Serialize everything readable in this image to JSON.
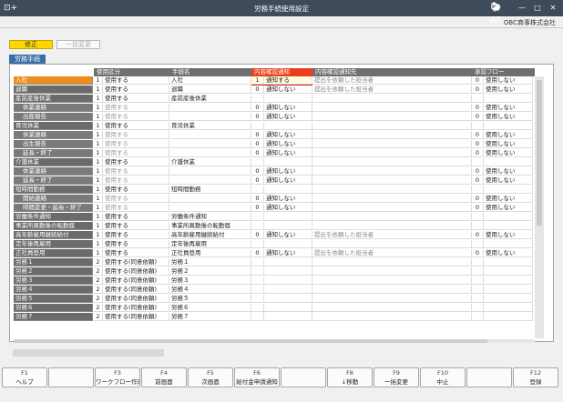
{
  "window": {
    "title": "労務手続使用設定",
    "app_icon": "⊡+",
    "logo": "🐑AT",
    "min": "—",
    "max": "□",
    "close": "✕"
  },
  "company": "OBC商事株式会社",
  "modes": {
    "edit": "修正",
    "bulk": "一括変更"
  },
  "tab": "労務手続",
  "headers": {
    "usage": "使用区分",
    "procedure": "手続名",
    "notify": "内容確認通知",
    "dest": "内容確認通知先",
    "flow": "承認フロー"
  },
  "rows": [
    {
      "name": "入社",
      "k1": "1",
      "v1": "使用する",
      "proc": "入社",
      "k2": "1",
      "v2": "通知する",
      "dest": "提出を依頼した担当者",
      "k3": "0",
      "v3": "使用しない",
      "sel": true,
      "sub": false
    },
    {
      "name": "退職",
      "k1": "1",
      "v1": "使用する",
      "proc": "退職",
      "k2": "0",
      "v2": "通知しない",
      "dest": "提出を依頼した担当者",
      "k3": "0",
      "v3": "使用しない",
      "sel": false,
      "sub": false
    },
    {
      "name": "産前産後休業",
      "k1": "1",
      "v1": "使用する",
      "proc": "産前産後休業",
      "k2": "",
      "v2": "",
      "dest": "",
      "k3": "",
      "v3": "",
      "sel": false,
      "sub": false
    },
    {
      "name": "休業連絡",
      "k1": "1",
      "v1": "使用する",
      "proc": "",
      "k2": "0",
      "v2": "通知しない",
      "dest": "",
      "k3": "0",
      "v3": "使用しない",
      "sel": false,
      "sub": true,
      "grey": true
    },
    {
      "name": "出産報告",
      "k1": "1",
      "v1": "使用する",
      "proc": "",
      "k2": "0",
      "v2": "通知しない",
      "dest": "",
      "k3": "0",
      "v3": "使用しない",
      "sel": false,
      "sub": true,
      "grey": true
    },
    {
      "name": "育児休業",
      "k1": "1",
      "v1": "使用する",
      "proc": "育児休業",
      "k2": "",
      "v2": "",
      "dest": "",
      "k3": "",
      "v3": "",
      "sel": false,
      "sub": false
    },
    {
      "name": "休業連絡",
      "k1": "1",
      "v1": "使用する",
      "proc": "",
      "k2": "0",
      "v2": "通知しない",
      "dest": "",
      "k3": "0",
      "v3": "使用しない",
      "sel": false,
      "sub": true,
      "grey": true
    },
    {
      "name": "出生報告",
      "k1": "1",
      "v1": "使用する",
      "proc": "",
      "k2": "0",
      "v2": "通知しない",
      "dest": "",
      "k3": "0",
      "v3": "使用しない",
      "sel": false,
      "sub": true,
      "grey": true
    },
    {
      "name": "延長・終了",
      "k1": "1",
      "v1": "使用する",
      "proc": "",
      "k2": "0",
      "v2": "通知しない",
      "dest": "",
      "k3": "0",
      "v3": "使用しない",
      "sel": false,
      "sub": true,
      "grey": true
    },
    {
      "name": "介護休業",
      "k1": "1",
      "v1": "使用する",
      "proc": "介護休業",
      "k2": "",
      "v2": "",
      "dest": "",
      "k3": "",
      "v3": "",
      "sel": false,
      "sub": false
    },
    {
      "name": "休業連絡",
      "k1": "1",
      "v1": "使用する",
      "proc": "",
      "k2": "0",
      "v2": "通知しない",
      "dest": "",
      "k3": "0",
      "v3": "使用しない",
      "sel": false,
      "sub": true,
      "grey": true
    },
    {
      "name": "延長・終了",
      "k1": "1",
      "v1": "使用する",
      "proc": "",
      "k2": "0",
      "v2": "通知しない",
      "dest": "",
      "k3": "0",
      "v3": "使用しない",
      "sel": false,
      "sub": true,
      "grey": true
    },
    {
      "name": "短時間勤務",
      "k1": "1",
      "v1": "使用する",
      "proc": "短時間勤務",
      "k2": "",
      "v2": "",
      "dest": "",
      "k3": "",
      "v3": "",
      "sel": false,
      "sub": false
    },
    {
      "name": "開始連絡",
      "k1": "1",
      "v1": "使用する",
      "proc": "",
      "k2": "0",
      "v2": "通知しない",
      "dest": "",
      "k3": "0",
      "v3": "使用しない",
      "sel": false,
      "sub": true,
      "grey": true
    },
    {
      "name": "時間変更・延長・終了",
      "k1": "1",
      "v1": "使用する",
      "proc": "",
      "k2": "0",
      "v2": "通知しない",
      "dest": "",
      "k3": "0",
      "v3": "使用しない",
      "sel": false,
      "sub": true,
      "grey": true
    },
    {
      "name": "労働条件通知",
      "k1": "1",
      "v1": "使用する",
      "proc": "労働条件通知",
      "k2": "",
      "v2": "",
      "dest": "",
      "k3": "",
      "v3": "",
      "sel": false,
      "sub": false
    },
    {
      "name": "事業所異動後の転勤届",
      "k1": "1",
      "v1": "使用する",
      "proc": "事業所異動後の転勤届",
      "k2": "",
      "v2": "",
      "dest": "",
      "k3": "",
      "v3": "",
      "sel": false,
      "sub": false
    },
    {
      "name": "高年齢雇用継続給付",
      "k1": "1",
      "v1": "使用する",
      "proc": "高年齢雇用継続給付",
      "k2": "0",
      "v2": "通知しない",
      "dest": "提出を依頼した担当者",
      "k3": "0",
      "v3": "使用しない",
      "sel": false,
      "sub": false
    },
    {
      "name": "定年後再雇用",
      "k1": "1",
      "v1": "使用する",
      "proc": "定年後再雇用",
      "k2": "",
      "v2": "",
      "dest": "",
      "k3": "",
      "v3": "",
      "sel": false,
      "sub": false
    },
    {
      "name": "正社員登用",
      "k1": "1",
      "v1": "使用する",
      "proc": "正社員登用",
      "k2": "0",
      "v2": "通知しない",
      "dest": "提出を依頼した担当者",
      "k3": "0",
      "v3": "使用しない",
      "sel": false,
      "sub": false
    },
    {
      "name": "労務１",
      "k1": "2",
      "v1": "使用する(同意依頼)",
      "proc": "労務１",
      "k2": "",
      "v2": "",
      "dest": "",
      "k3": "",
      "v3": "",
      "sel": false,
      "sub": false
    },
    {
      "name": "労務２",
      "k1": "2",
      "v1": "使用する(同意依頼)",
      "proc": "労務２",
      "k2": "",
      "v2": "",
      "dest": "",
      "k3": "",
      "v3": "",
      "sel": false,
      "sub": false
    },
    {
      "name": "労務３",
      "k1": "2",
      "v1": "使用する(同意依頼)",
      "proc": "労務３",
      "k2": "",
      "v2": "",
      "dest": "",
      "k3": "",
      "v3": "",
      "sel": false,
      "sub": false
    },
    {
      "name": "労務４",
      "k1": "2",
      "v1": "使用する(同意依頼)",
      "proc": "労務４",
      "k2": "",
      "v2": "",
      "dest": "",
      "k3": "",
      "v3": "",
      "sel": false,
      "sub": false
    },
    {
      "name": "労務５",
      "k1": "2",
      "v1": "使用する(同意依頼)",
      "proc": "労務５",
      "k2": "",
      "v2": "",
      "dest": "",
      "k3": "",
      "v3": "",
      "sel": false,
      "sub": false
    },
    {
      "name": "労務６",
      "k1": "2",
      "v1": "使用する(同意依頼)",
      "proc": "労務６",
      "k2": "",
      "v2": "",
      "dest": "",
      "k3": "",
      "v3": "",
      "sel": false,
      "sub": false
    },
    {
      "name": "労務７",
      "k1": "2",
      "v1": "使用する(同意依頼)",
      "proc": "労務７",
      "k2": "",
      "v2": "",
      "dest": "",
      "k3": "",
      "v3": "",
      "sel": false,
      "sub": false
    }
  ],
  "fkeys": [
    {
      "key": "F1",
      "label": "ヘルプ"
    },
    {
      "key": "",
      "label": ""
    },
    {
      "key": "F3",
      "label": "ワークフロー作成"
    },
    {
      "key": "F4",
      "label": "前画面"
    },
    {
      "key": "F5",
      "label": "次画面"
    },
    {
      "key": "F6",
      "label": "給付金申請通知"
    },
    {
      "key": "",
      "label": ""
    },
    {
      "key": "F8",
      "label": "↓移動"
    },
    {
      "key": "F9",
      "label": "一括変更"
    },
    {
      "key": "F10",
      "label": "中止"
    },
    {
      "key": "",
      "label": ""
    },
    {
      "key": "F12",
      "label": "登録"
    }
  ]
}
